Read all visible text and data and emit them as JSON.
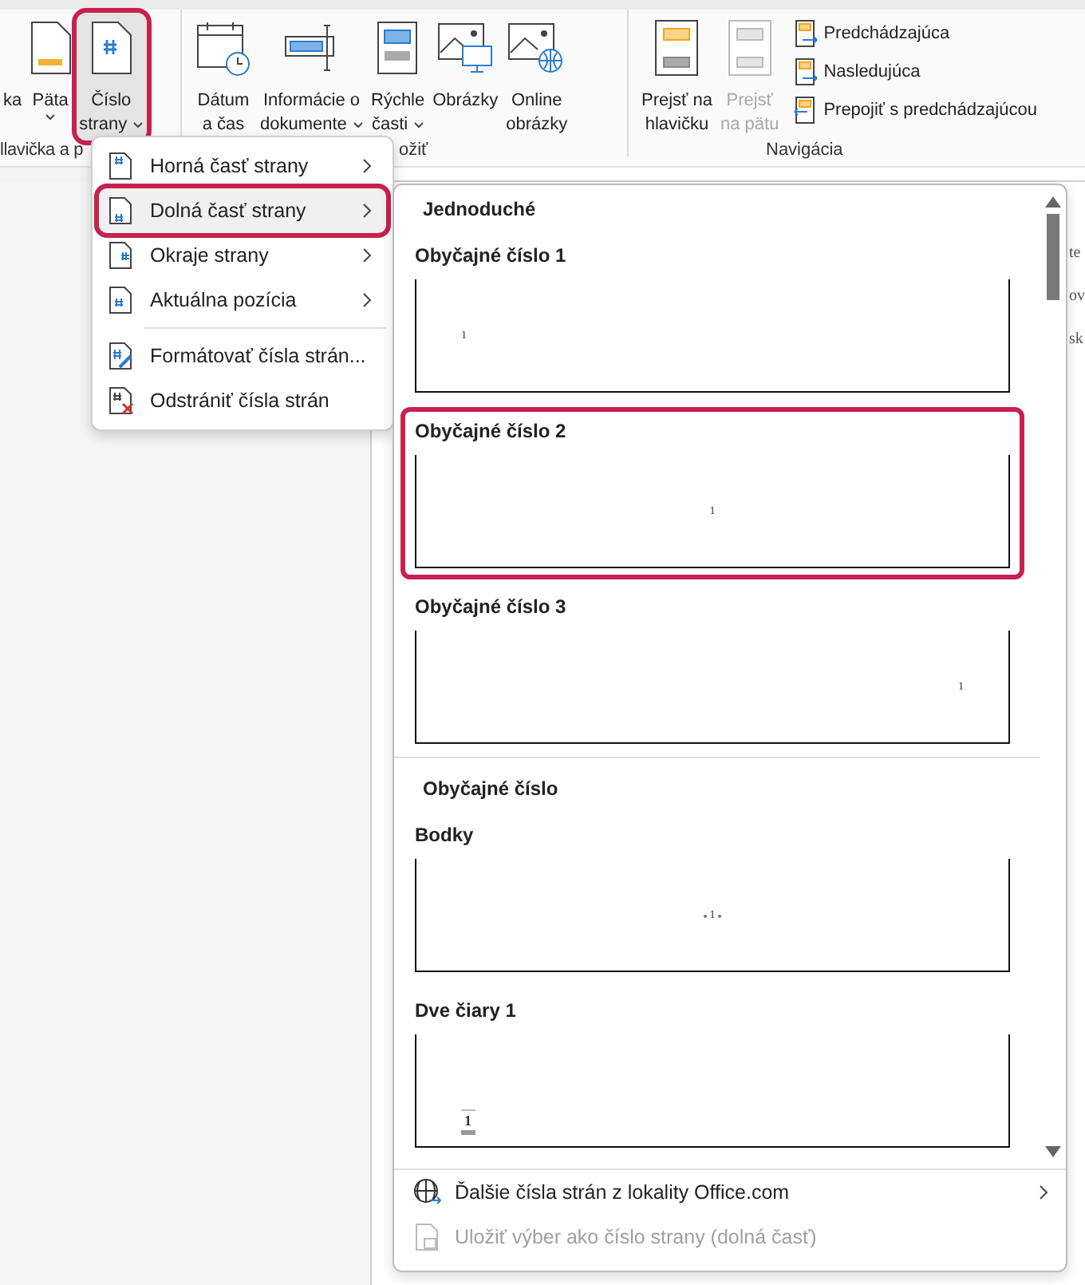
{
  "ribbon": {
    "groups": [
      {
        "label": "llavička a p",
        "buttons": [
          {
            "lines": [
              "ka"
            ],
            "dropdown": false,
            "selected": false,
            "disabled": false
          },
          {
            "lines": [
              "Päta"
            ],
            "dropdown": true,
            "selected": false,
            "disabled": false
          },
          {
            "lines": [
              "Číslo",
              "strany"
            ],
            "dropdown": true,
            "selected": true,
            "disabled": false
          }
        ]
      },
      {
        "label": "ožiť",
        "buttons": [
          {
            "lines": [
              "Dátum",
              "a čas"
            ],
            "dropdown": false,
            "selected": false,
            "disabled": false
          },
          {
            "lines": [
              "Informácie o",
              "dokumente"
            ],
            "dropdown": true,
            "selected": false,
            "disabled": false
          },
          {
            "lines": [
              "Rýchle",
              "časti"
            ],
            "dropdown": true,
            "selected": false,
            "disabled": false
          },
          {
            "lines": [
              "Obrázky"
            ],
            "dropdown": false,
            "selected": false,
            "disabled": false
          },
          {
            "lines": [
              "Online",
              "obrázky"
            ],
            "dropdown": false,
            "selected": false,
            "disabled": false
          }
        ]
      },
      {
        "label": "Navigácia",
        "buttons": [
          {
            "lines": [
              "Prejsť na",
              "hlavičku"
            ],
            "dropdown": false,
            "selected": false,
            "disabled": false
          },
          {
            "lines": [
              "Prejsť",
              "na pätu"
            ],
            "dropdown": false,
            "selected": false,
            "disabled": true
          }
        ],
        "small_buttons": [
          "Predchádzajúca",
          "Nasledujúca",
          "Prepojiť s predchádzajúcou"
        ]
      }
    ]
  },
  "page_menu": {
    "sections": [
      [
        {
          "label": "Horná časť strany",
          "submenu": true,
          "selected": false
        },
        {
          "label": "Dolná časť strany",
          "submenu": true,
          "selected": true
        },
        {
          "label": "Okraje strany",
          "submenu": true,
          "selected": false
        },
        {
          "label": "Aktuálna pozícia",
          "submenu": true,
          "selected": false
        }
      ],
      [
        {
          "label": "Formátovať čísla strán...",
          "submenu": false,
          "selected": false
        },
        {
          "label": "Odstrániť čísla strán",
          "submenu": false,
          "selected": false
        }
      ]
    ]
  },
  "gallery": {
    "entries": [
      {
        "kind": "category",
        "label": "Jednoduché"
      },
      {
        "kind": "preview",
        "title": "Obyčajné číslo 1",
        "number": "1",
        "selected": false
      },
      {
        "kind": "preview",
        "title": "Obyčajné číslo 2",
        "number": "1",
        "selected": true
      },
      {
        "kind": "preview",
        "title": "Obyčajné číslo 3",
        "number": "1",
        "selected": false
      },
      {
        "kind": "category",
        "label": "Obyčajné číslo"
      },
      {
        "kind": "preview",
        "title": "Bodky",
        "number": "1",
        "selected": false
      },
      {
        "kind": "preview",
        "title": "Dve čiary 1",
        "number": "1",
        "selected": false
      }
    ],
    "footer": [
      {
        "label": "Ďalšie čísla strán z lokality Office.com",
        "submenu": true,
        "disabled": false
      },
      {
        "label": "Uložiť výber ako číslo strany (dolná časť)",
        "submenu": false,
        "disabled": true
      }
    ]
  },
  "document": {
    "lines": [
      "te",
      "ov",
      "sk"
    ]
  }
}
